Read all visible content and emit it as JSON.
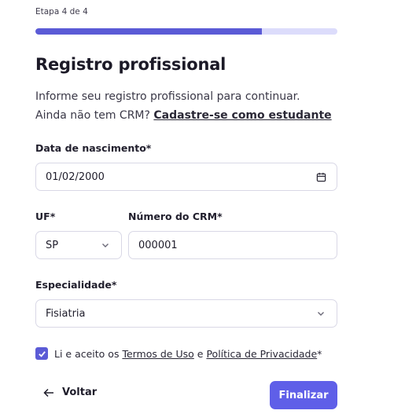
{
  "step": {
    "label": "Etapa 4 de 4",
    "progress": 0.75
  },
  "header": {
    "title": "Registro profissional",
    "subtitle_line1": "Informe seu registro profissional para continuar.",
    "subtitle_line2": "Ainda não tem CRM?",
    "student_link": "Cadastre-se como estudante"
  },
  "form": {
    "birthdate": {
      "label": "Data de nascimento*",
      "value": "01/02/2000",
      "icon": "calendar-icon"
    },
    "uf": {
      "label": "UF*",
      "value": "SP",
      "icon": "chevron-down-icon"
    },
    "crm": {
      "label": "Número do CRM*",
      "value": "000001"
    },
    "specialty": {
      "label": "Especialidade*",
      "value": "Fisiatria",
      "icon": "chevron-down-icon"
    },
    "terms": {
      "checked": true,
      "text_prefix": "Li e aceito os",
      "terms_link": "Termos de Uso",
      "conjunction": "e",
      "privacy_link": "Política de Privacidade",
      "suffix": "*"
    }
  },
  "actions": {
    "back_label": "Voltar",
    "back_icon": "arrow-left-icon",
    "finish_label": "Finalizar"
  },
  "colors": {
    "accent": "#5b5bd6",
    "accent_track": "#dcdcfb",
    "button": "#5f5fe8",
    "border": "#d9d8e6"
  }
}
